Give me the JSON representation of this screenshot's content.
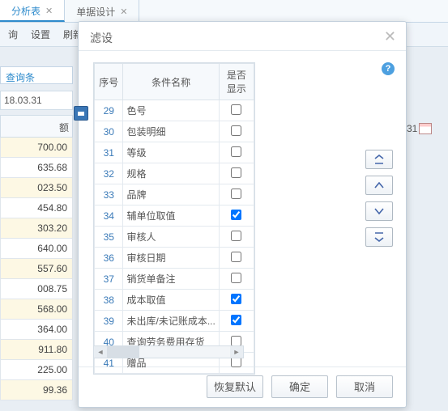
{
  "bg": {
    "tabs": [
      {
        "label": "分析表",
        "active": true
      },
      {
        "label": "单据设计",
        "active": false
      }
    ],
    "toolbar": [
      "询",
      "设置",
      "刷新"
    ],
    "query_label": "查询条",
    "date1": "18.03.31",
    "col_head": "额",
    "date2": "31",
    "cells": [
      "700.00",
      "635.68",
      "023.50",
      "454.80",
      "303.20",
      "640.00",
      "557.60",
      "008.75",
      "568.00",
      "364.00",
      "911.80",
      "225.00",
      "99.36"
    ]
  },
  "dialog": {
    "title": "滤设",
    "columns": {
      "sn": "序号",
      "name": "条件名称",
      "show": "是否显示"
    },
    "rows": [
      {
        "sn": 29,
        "name": "色号",
        "checked": false
      },
      {
        "sn": 30,
        "name": "包装明细",
        "checked": false
      },
      {
        "sn": 31,
        "name": "等级",
        "checked": false
      },
      {
        "sn": 32,
        "name": "规格",
        "checked": false
      },
      {
        "sn": 33,
        "name": "品牌",
        "checked": false
      },
      {
        "sn": 34,
        "name": "辅单位取值",
        "checked": true
      },
      {
        "sn": 35,
        "name": "审核人",
        "checked": false
      },
      {
        "sn": 36,
        "name": "审核日期",
        "checked": false
      },
      {
        "sn": 37,
        "name": "销货单备注",
        "checked": false
      },
      {
        "sn": 38,
        "name": "成本取值",
        "checked": true
      },
      {
        "sn": 39,
        "name": "未出库/未记账成本...",
        "checked": true
      },
      {
        "sn": 40,
        "name": "查询劳务费用存货",
        "checked": false
      },
      {
        "sn": 41,
        "name": "赠品",
        "checked": false
      }
    ],
    "buttons": {
      "restore": "恢复默认",
      "ok": "确定",
      "cancel": "取消"
    }
  }
}
